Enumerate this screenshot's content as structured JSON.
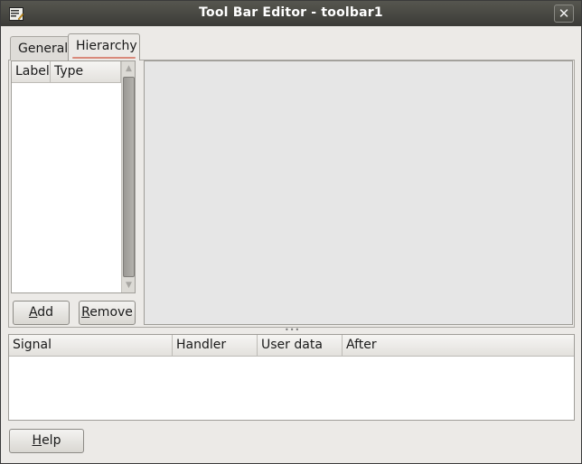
{
  "window": {
    "title": "Tool Bar Editor - toolbar1",
    "close_glyph": "✕",
    "icon": "editor-window-icon"
  },
  "tabs": [
    {
      "label": "General",
      "selected": false
    },
    {
      "label": "Hierarchy",
      "selected": true
    }
  ],
  "hierarchy": {
    "columns": [
      "Label",
      "Type"
    ],
    "rows": [],
    "scroll_up_glyph": "▲",
    "scroll_down_glyph": "▼"
  },
  "buttons": {
    "add": {
      "mnemonic": "A",
      "rest": "dd"
    },
    "remove": {
      "mnemonic": "R",
      "rest": "emove"
    },
    "help": {
      "mnemonic": "H",
      "rest": "elp"
    }
  },
  "pane_grip": "•••",
  "signals": {
    "columns": [
      "Signal",
      "Handler",
      "User data",
      "After"
    ],
    "rows": []
  }
}
